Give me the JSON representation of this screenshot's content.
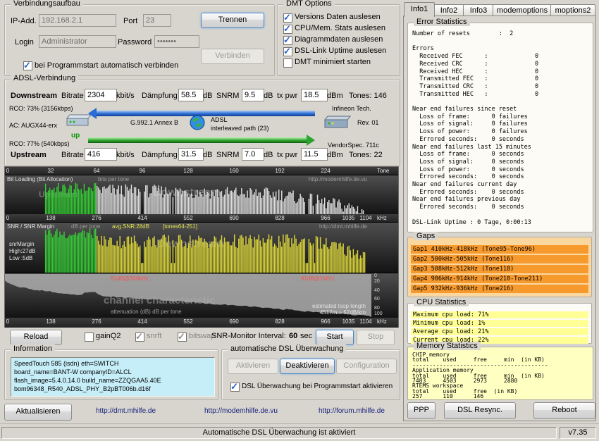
{
  "connection": {
    "title": "Verbindungsaufbau",
    "ip_label": "IP-Add.",
    "ip_value": "192.168.2.1",
    "port_label": "Port",
    "port_value": "23",
    "login_label": "Login",
    "login_value": "Administrator",
    "password_label": "Password",
    "password_value": "•••••••",
    "autoconnect_label": "bei Programmstart automatisch verbinden",
    "autoconnect_checked": true,
    "disconnect_button": "Trennen",
    "connect_button": "Verbinden"
  },
  "dmt_options": {
    "title": "DMT Options",
    "items": [
      {
        "label": "Versions Daten auslesen",
        "checked": true
      },
      {
        "label": "CPU/Mem. Stats auslesen",
        "checked": true
      },
      {
        "label": "Diagrammdaten auslesen",
        "checked": true
      },
      {
        "label": "DSL-Link Uptime auslesen",
        "checked": true
      },
      {
        "label": "DMT minimiert starten",
        "checked": false
      }
    ]
  },
  "adsl": {
    "title": "ADSL-Verbindung",
    "downstream": {
      "label": "Downstream",
      "bitrate_label": "Bitrate",
      "bitrate": "2304",
      "unit": "kbit/s",
      "daempfung_label": "Dämpfung",
      "daempfung": "58.5",
      "db1": "dB",
      "snrm_label": "SNRM",
      "snrm": "9.5",
      "db2": "dB",
      "txpwr_label": "tx pwr",
      "txpwr": "18.5",
      "dbm": "dBm",
      "tones": "Tones: 146"
    },
    "upstream": {
      "label": "Upstream",
      "bitrate_label": "Bitrate",
      "bitrate": "416",
      "unit": "kbit/s",
      "daempfung_label": "Dämpfung",
      "daempfung": "31.5",
      "db1": "dB",
      "snrm_label": "SNRM",
      "snrm": "7.0",
      "db2": "dB",
      "txpwr_label": "tx pwr",
      "txpwr": "11.5",
      "dbm": "dBm",
      "tones": "Tones: 22"
    },
    "rco_down": "RCO: 73% (3156kbps)",
    "rco_up": "RCO: 77% (540kbps)",
    "local_modem": "AC: AUGX44-erx",
    "link_status": "up",
    "standard": "G.992.1 Annex B",
    "adsl_label": "ADSL",
    "path": "interleaved path (23)",
    "vendor": "Infineon Tech.",
    "vendor_rev": "Rev. 01",
    "vendor_spec": "VendorSpec. 711c"
  },
  "charts": {
    "tone_axis": [
      "0",
      "32",
      "64",
      "96",
      "128",
      "160",
      "192",
      "224"
    ],
    "tone_unit": "Tone",
    "khz_axis": [
      "0",
      "138",
      "276",
      "414",
      "552",
      "690",
      "828",
      "966",
      "1035",
      "1104"
    ],
    "khz_unit": "kHz",
    "bitloading": {
      "title": "Bit Loading (Bit Allocation)",
      "subtitle": "bits per tone",
      "url": "http://modemhilfe.de.vu",
      "watermark_up": "Upstream",
      "watermark_down": "Downstream"
    },
    "snr": {
      "title": "SNR / SNR Margin",
      "subtitle": "dB per tone",
      "avg": "avg.SNR:28dB",
      "range": "[tones64-251]",
      "url": "http://dmt.mhilfe.de",
      "margin1": "snrMargin",
      "margin2": "High:27dB",
      "margin3": "Low :5dB",
      "watermark": "Downstream"
    },
    "channel": {
      "watermark": "channel characteristic",
      "subtitle": "attenuation (dB)  dB per tone",
      "anno_left": "51dB@300kHz",
      "anno_right": "91dB@1MHz",
      "loop1": "estimated loop length",
      "loop2": "4517m ~ 57dB/km",
      "right_axis": [
        "0",
        "20",
        "40",
        "60",
        "80",
        "100"
      ]
    }
  },
  "chart_controls": {
    "reload": "Reload",
    "gainq2": "gainQ2",
    "gainq2_checked": false,
    "snrft": "snrft",
    "snrft_checked": true,
    "bitswap": "bitswap",
    "bitswap_checked": true,
    "interval_label": "SNR-Monitor Interval:",
    "interval_value": "60",
    "interval_unit": "sec",
    "start": "Start",
    "stop": "Stop"
  },
  "information": {
    "title": "Information",
    "lines": [
      "SpeedTouch 585 (isdn) eth=SWITCH",
      "board_name=BANT-W  companyID=ALCL",
      "flash_image=5.4.0.14.0  build_name=ZZQGAA5.40E",
      "bom96348_R540_ADSL_PHY_B2pBT006b.d16f"
    ]
  },
  "monitoring": {
    "title": "automatische DSL Überwachung",
    "activate": "Aktivieren",
    "deactivate": "Deaktivieren",
    "configuration": "Configuration",
    "checkbox_label": "DSL Überwachung bei Programmstart aktivieren",
    "checkbox_checked": true
  },
  "footer": {
    "refresh": "Aktualisieren",
    "links": [
      "http://dmt.mhilfe.de",
      "http://modemhilfe.de.vu",
      "http://forum.mhilfe.de"
    ],
    "ppp": "PPP",
    "resync": "DSL Resync.",
    "reboot": "Reboot"
  },
  "statusbar": {
    "text": "Automatische DSL Überwachung ist aktiviert",
    "version": "v7.35"
  },
  "tabs": [
    "Info1",
    "Info2",
    "Info3",
    "modemoptions",
    "moptions2"
  ],
  "error_statistics": {
    "title": "Error Statistics",
    "text": "Number of resets        :  2\n\nErrors\n  Received FEC      :             0\n  Received CRC      :             0\n  Received HEC      :             0\n  Transmitted FEC   :             0\n  Transmitted CRC   :             0\n  Transmitted HEC   :             0\n\nNear end failures since reset\n  Loss of frame:      0 failures\n  Loss of signal:     0 failures\n  Loss of power:      0 failures\n  Errored seconds:    0 seconds\nNear end failures last 15 minutes\n  Loss of frame:      0 seconds\n  Loss of signal:     0 seconds\n  Loss of power:      0 seconds\n  Errored seconds:    0 seconds\nNear end failures current day\n  Errored seconds:    0 seconds\nNear end failures previous day\n  Errored seconds:    0 seconds\n\nDSL-Link Uptime : 0 Tage, 0:00:13"
  },
  "gaps": {
    "title": "Gaps",
    "rows": [
      "Gap1 410kHz-418kHz (Tone95-Tone96)",
      "Gap2 500kHz-505kHz (Tone116)",
      "Gap3 508kHz-512kHz (Tone118)",
      "Gap4 906kHz-914kHz (Tone210-Tone211)",
      "Gap5 932kHz-936kHz (Tone216)"
    ]
  },
  "cpu": {
    "title": "CPU Statistics",
    "rows": [
      "Maximum cpu load: 71%",
      "Minimum cpu load: 1%",
      "Average cpu load: 21%",
      "Current cpu load: 22%"
    ]
  },
  "memory": {
    "title": "Memory Statistics",
    "text": "CHIP memory\ntotal    used     free     min  (in KB)\n----------------------------------------\nApplication memory\ntotal    used     free     min  (in KB)\n7483     4503     2973     2880\nRTEMS workspace\ntotal    used     free  (in KB)\n257      110      146"
  }
}
